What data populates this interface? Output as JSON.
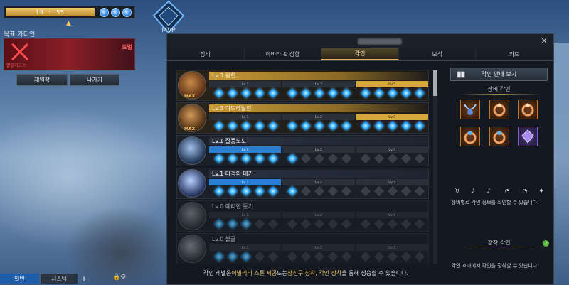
{
  "hud": {
    "time": "18 : 55",
    "goal_title": "목표 가디언",
    "boss_name": "칼엘리고스",
    "boss_tag": "토벌",
    "reenter": "재입장",
    "exit": "나가기"
  },
  "mvp": {
    "label": "MVP"
  },
  "chat": {
    "tab1": "일반",
    "tab2": "시스템",
    "plus": "+"
  },
  "window": {
    "close": "×",
    "tabs": [
      "장비",
      "아바타 & 성향",
      "각인",
      "보석",
      "카드"
    ],
    "active_tab": "각인"
  },
  "engravings": [
    {
      "name": "Lv.3 원한",
      "level": 3,
      "style": "gold",
      "max": "MAX",
      "levels": [
        "Lv.1",
        "Lv.2",
        "Lv.3"
      ],
      "gems_on": 15
    },
    {
      "name": "Lv.3 아드레날린",
      "level": 3,
      "style": "gold",
      "max": "MAX",
      "levels": [
        "Lv.1",
        "Lv.2",
        "Lv.3"
      ],
      "gems_on": 15
    },
    {
      "name": "Lv.1 질풍노도",
      "level": 1,
      "style": "blue",
      "max": "",
      "levels": [
        "Lv.1",
        "Lv.2",
        "Lv.3"
      ],
      "gems_on": 6
    },
    {
      "name": "Lv.1 타격의 대가",
      "level": 1,
      "style": "blue",
      "max": "",
      "levels": [
        "Lv.1",
        "Lv.2",
        "Lv.3"
      ],
      "gems_on": 6
    },
    {
      "name": "Lv.0 예리한 둔기",
      "level": 0,
      "style": "dim",
      "max": "",
      "levels": [
        "Lv.1",
        "Lv.2",
        "Lv.3"
      ],
      "gems_on": 3
    },
    {
      "name": "Lv.0 불굴",
      "level": 0,
      "style": "dim",
      "max": "",
      "levels": [
        "Lv.1",
        "Lv.2",
        "Lv.3"
      ],
      "gems_on": 3
    }
  ],
  "footer": {
    "prefix": "각인 레벨은 ",
    "hl1": "어빌리티 스톤 세공",
    "mid1": " 또는 ",
    "hl2": "장신구 장착, 각인 장착",
    "suffix": "을 통해 상승할 수 있습니다."
  },
  "right": {
    "guide_button": "각인 안내 보기",
    "equip_title": "장비 각인",
    "equip_info": "장비별로 각인 정보를 확인할 수 있습니다.",
    "mount_title": "장착 각인",
    "help": "?",
    "mount_info": "각인 효과에서 각인을 장착할 수 있습니다.",
    "slot_icons": [
      "necklace-icon",
      "earring-icon",
      "earring-icon",
      "ring-icon",
      "ring-icon",
      "ability-stone-icon"
    ],
    "mini_icons": [
      "necklace-icon",
      "earring-1-icon",
      "earring-2-icon",
      "ring-1-icon",
      "ring-2-icon",
      "stone-icon"
    ]
  },
  "colors": {
    "accent_gold": "#d7a73c",
    "accent_blue": "#2b7fd0",
    "gem": "#36b3ff"
  }
}
